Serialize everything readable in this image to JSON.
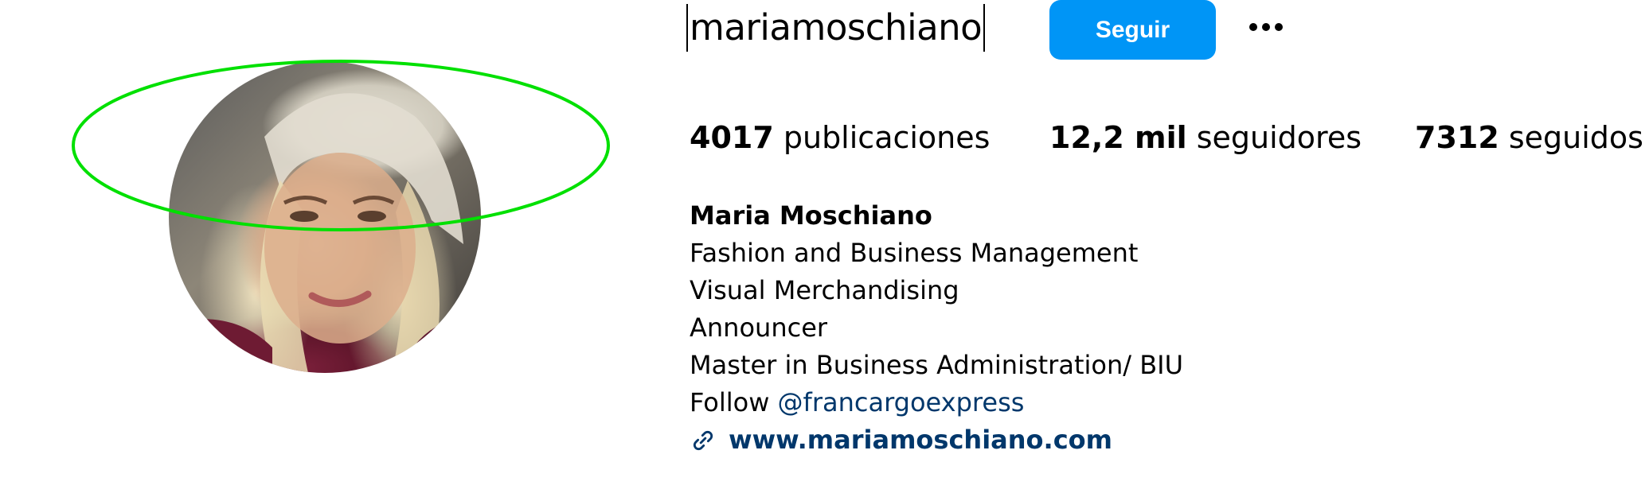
{
  "profile": {
    "username": "mariamoschiano",
    "follow_label": "Seguir",
    "more_icon": "more-options-icon",
    "avatar_icon": "profile-photo"
  },
  "stats": {
    "posts_count": "4017",
    "posts_label": "publicaciones",
    "followers_count": "12,2 mil",
    "followers_label": "seguidores",
    "following_count": "7312",
    "following_label": "seguidos"
  },
  "bio": {
    "name": "Maria Moschiano",
    "lines": [
      "Fashion and Business Management",
      "Visual Merchandising",
      "Announcer",
      "Master in Business Administration/ BIU"
    ],
    "follow_prefix": "Follow ",
    "mention": "@francargoexpress",
    "website": "www.mariamoschiano.com"
  },
  "colors": {
    "accent": "#0095f6",
    "link": "#00376b",
    "annotation": "#00e000"
  }
}
